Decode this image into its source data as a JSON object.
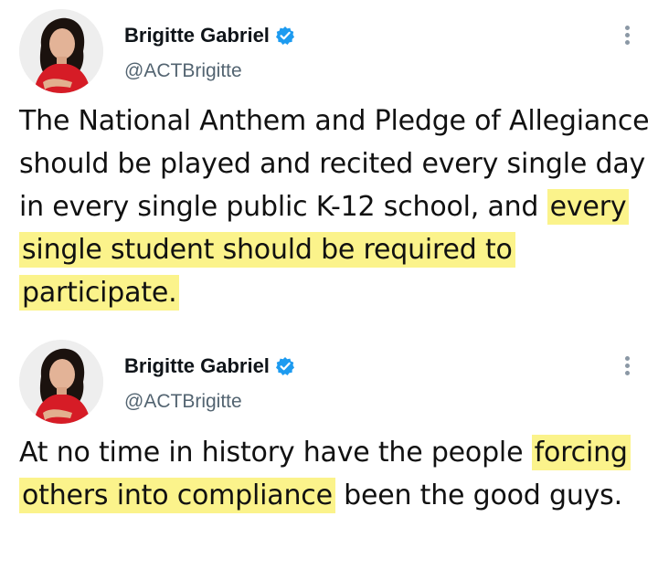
{
  "tweets": [
    {
      "display_name": "Brigitte Gabriel",
      "handle": "@ACTBrigitte",
      "verified": true,
      "text_before": "The National Anthem and Pledge of Allegiance should be played and recited every single day in every single public K-12 school, and ",
      "text_highlight": "every single student should be required to participate.",
      "text_after": ""
    },
    {
      "display_name": "Brigitte Gabriel",
      "handle": "@ACTBrigitte",
      "verified": true,
      "text_before": "At no time in history have the people ",
      "text_highlight": "forcing others into compliance",
      "text_after": " been the good guys."
    }
  ],
  "colors": {
    "highlight": "#fbf38b",
    "verified_badge": "#1d9bf0",
    "handle_text": "#536471",
    "more_dots": "#8b98a5"
  },
  "icons": {
    "verified": "verified-badge-icon",
    "more": "more-options-icon"
  }
}
